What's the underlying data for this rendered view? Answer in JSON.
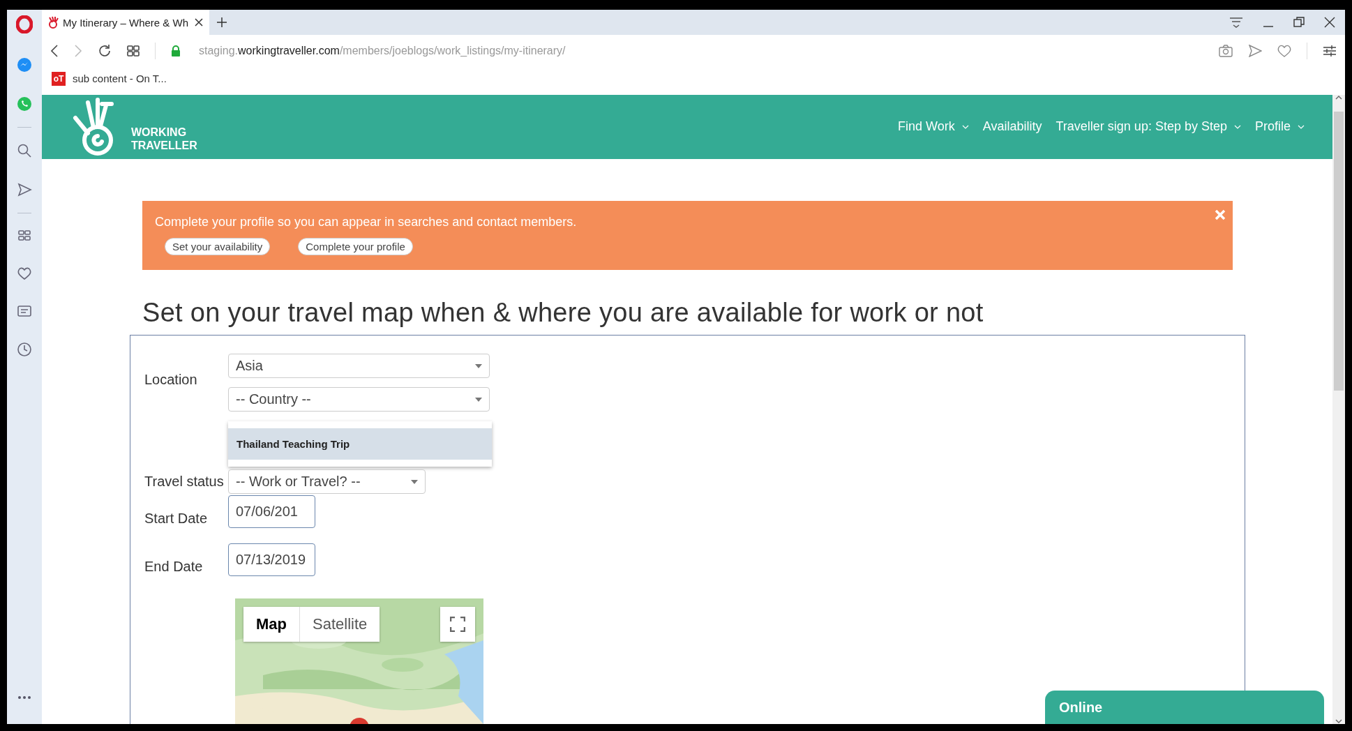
{
  "browser": {
    "tab": {
      "title": "My Itinerary – Where & Wh"
    },
    "address": {
      "host_prefix": "staging.",
      "domain": "workingtraveller.com",
      "path": "/members/joeblogs/work_listings/my-itinerary/"
    },
    "bookmarks": [
      {
        "favicon_text": "oT",
        "label": "sub content - On T..."
      }
    ]
  },
  "site": {
    "logo": {
      "line1": "WORKING",
      "line2": "TRAVELLER"
    },
    "nav": [
      {
        "label": "Find Work",
        "dropdown": true
      },
      {
        "label": "Availability",
        "dropdown": false
      },
      {
        "label": "Traveller sign up: Step by Step",
        "dropdown": true
      },
      {
        "label": "Profile",
        "dropdown": true
      }
    ]
  },
  "alert": {
    "message": "Complete your profile so you can appear in searches and contact members.",
    "buttons": [
      "Set your availability",
      "Complete your profile"
    ]
  },
  "heading": "Set on your travel map when & where you are available for work or not",
  "form": {
    "location": {
      "label": "Location",
      "region": "Asia",
      "country": "-- Country --",
      "suggestions": [
        {
          "label": "Thailand Teaching Trip",
          "selected": true
        }
      ]
    },
    "travel_status": {
      "label": "Travel status",
      "value": "-- Work or Travel? --"
    },
    "start_date": {
      "label": "Start Date",
      "value": "07/06/201"
    },
    "end_date": {
      "label": "End Date",
      "value": "07/13/2019"
    }
  },
  "map": {
    "types": [
      {
        "label": "Map",
        "selected": true
      },
      {
        "label": "Satellite",
        "selected": false
      }
    ]
  },
  "chat": {
    "status": "Online"
  }
}
